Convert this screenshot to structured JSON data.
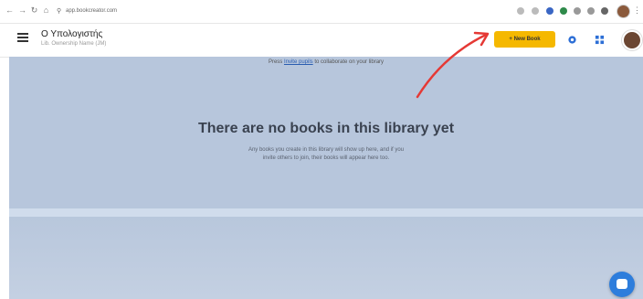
{
  "browser": {
    "url": "app.bookcreator.com",
    "back_icon": "arrow-left-icon",
    "forward_icon": "arrow-right-icon",
    "reload_icon": "reload-icon",
    "home_icon": "home-icon"
  },
  "header": {
    "library_title": "Ο Υπολογιστής",
    "library_subtitle": "Lib. Ownership Name (JM)",
    "new_book_label": "+ New Book"
  },
  "main": {
    "info_prefix": "Press ",
    "info_link": "Invite pupils",
    "info_suffix": " to collaborate on your library",
    "empty_title": "There are no books in this library yet",
    "empty_text_line1": "Any books you create in this library will show up here, and if you",
    "empty_text_line2": "invite others to join, their books will appear here too."
  },
  "colors": {
    "accent": "#f5b800",
    "background": "#b7c6dc",
    "chat": "#2d7ddc",
    "annotation": "#e53935"
  }
}
